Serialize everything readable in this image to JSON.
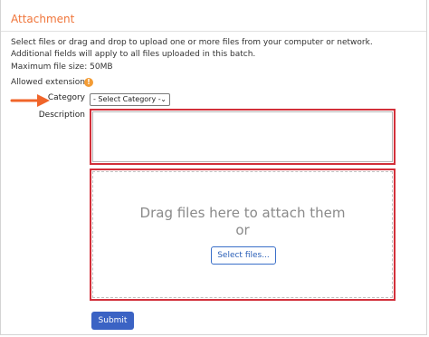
{
  "section": {
    "title": "Attachment"
  },
  "instructions": {
    "line1": "Select files or drag and drop to upload one or more files from your computer or network. Additional fields will apply to all files uploaded in this batch.",
    "max_size": "Maximum file size: 50MB",
    "allowed": "Allowed extensions",
    "info_glyph": "!"
  },
  "form": {
    "category_label": "Category",
    "category_value": "- Select Category -",
    "category_chevron": "⌄",
    "description_label": "Description",
    "description_value": ""
  },
  "dropzone": {
    "line1": "Drag files here to attach them",
    "line2": "or",
    "button": "Select files..."
  },
  "submit": {
    "label": "Submit"
  },
  "colors": {
    "accent_orange": "#f0753a",
    "highlight_red": "#d2303a",
    "primary_blue": "#3b63c4"
  },
  "icons": {
    "info": "info-icon",
    "pointer": "arrow-right-icon"
  }
}
